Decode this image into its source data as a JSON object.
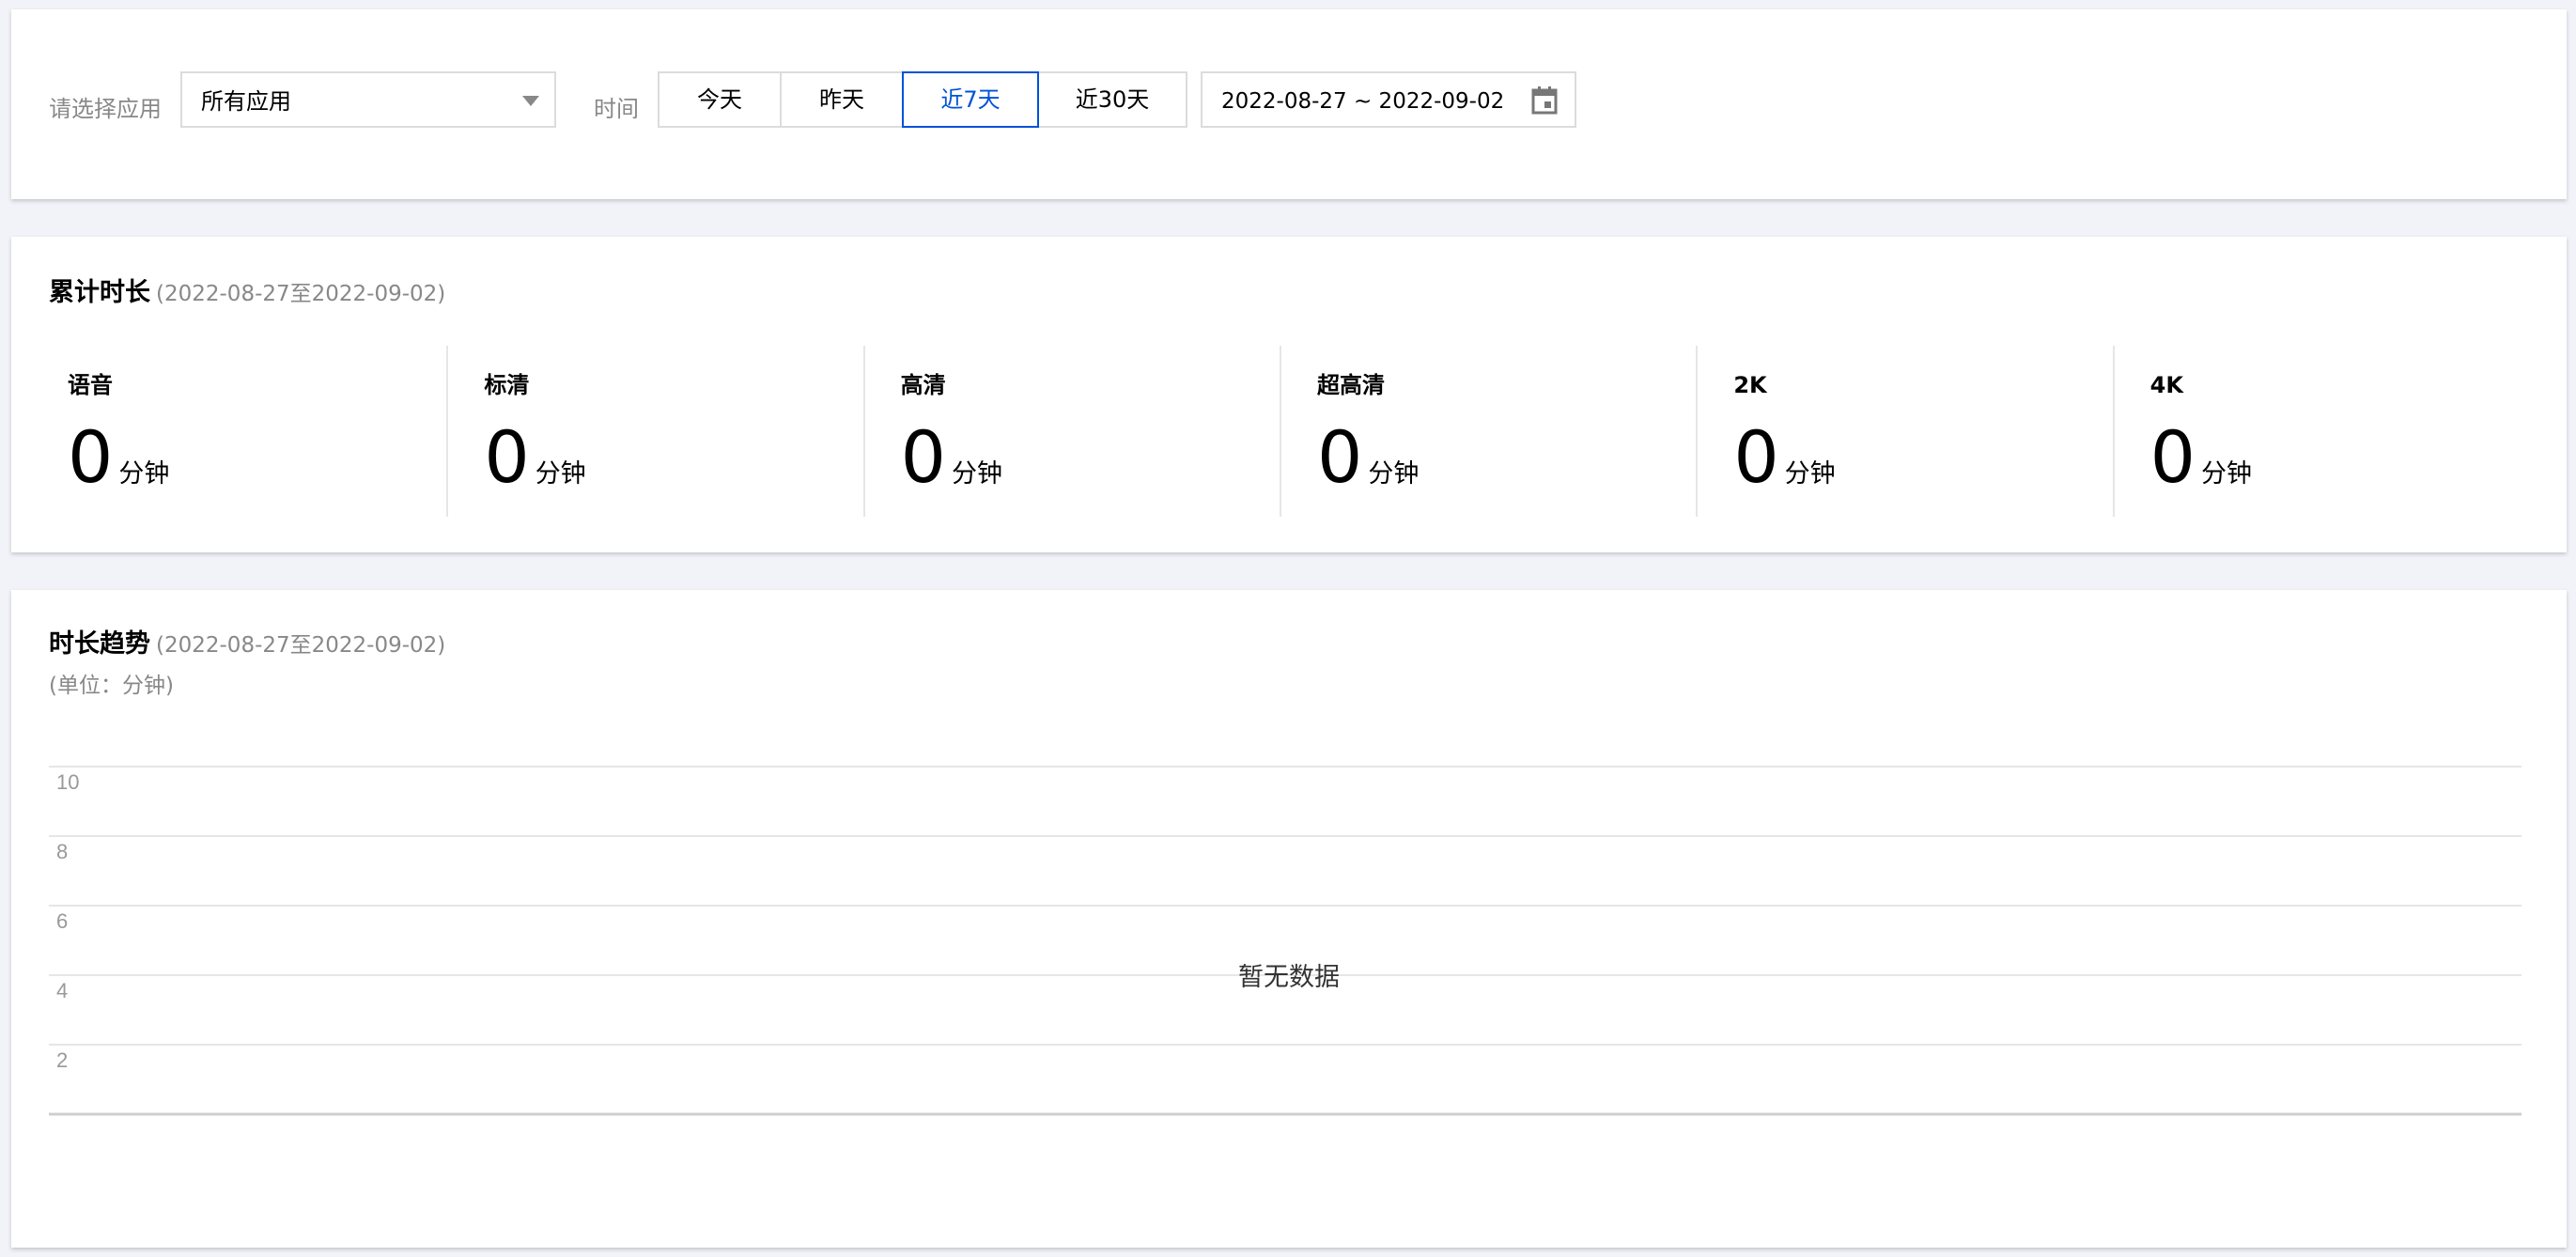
{
  "filter": {
    "app_label": "请选择应用",
    "app_value": "所有应用",
    "time_label": "时间",
    "time_options": [
      "今天",
      "昨天",
      "近7天",
      "近30天"
    ],
    "time_selected": "近7天",
    "date_range": "2022-08-27 ~ 2022-09-02"
  },
  "total": {
    "title": "累计时长",
    "range": "(2022-08-27至2022-09-02)",
    "metrics": [
      {
        "label": "语音",
        "value": "0",
        "unit": "分钟"
      },
      {
        "label": "标清",
        "value": "0",
        "unit": "分钟"
      },
      {
        "label": "高清",
        "value": "0",
        "unit": "分钟"
      },
      {
        "label": "超高清",
        "value": "0",
        "unit": "分钟"
      },
      {
        "label": "2K",
        "value": "0",
        "unit": "分钟"
      },
      {
        "label": "4K",
        "value": "0",
        "unit": "分钟"
      }
    ]
  },
  "trend": {
    "title": "时长趋势",
    "range": "(2022-08-27至2022-09-02)",
    "unit_note": "(单位：分钟)",
    "empty_text": "暂无数据"
  },
  "chart_data": {
    "type": "line",
    "title": "时长趋势",
    "subtitle": "(2022-08-27至2022-09-02)",
    "ylabel": "(单位：分钟)",
    "xlabel": "",
    "yticks": [
      10,
      8,
      6,
      4,
      2
    ],
    "ylim": [
      0,
      10
    ],
    "series": [],
    "grid": true,
    "empty_text": "暂无数据"
  },
  "colors": {
    "accent": "#0052d9",
    "background": "#f2f3f8",
    "border": "#dcdcdc"
  },
  "icons": {
    "select_caret": "caret-down-icon",
    "date_picker": "calendar-icon"
  }
}
